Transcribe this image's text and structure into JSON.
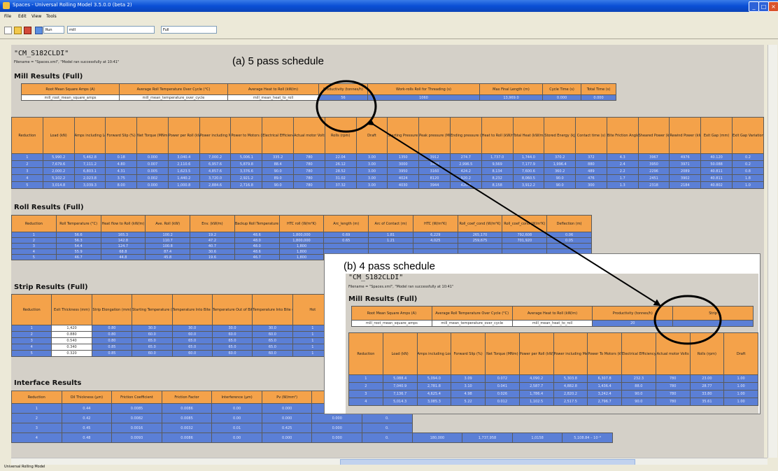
{
  "window": {
    "title": "Spaces - Universal Rolling Model 3.5.0.0 (beta 2)",
    "buttons": {
      "min": "_",
      "max": "□",
      "close": "×"
    }
  },
  "menu": [
    "File",
    "Edit",
    "View",
    "Tools"
  ],
  "toolbar": {
    "field1": "Run",
    "field2": "mill",
    "field3": "Full"
  },
  "report": {
    "title": "\"CM_S182CLDI\"",
    "filename": "Filename = \"Spaces.xml\", \"Model ran successfully at 10:41\""
  },
  "annotations": {
    "a": "(a) 5 pass schedule",
    "b": "(b) 4 pass schedule"
  },
  "mill": {
    "heading": "Mill Results (Full)",
    "summary_headers": [
      "Root Mean Square Amps (A)",
      "Average Roll Temperature Over Cycle (°C)",
      "Average Heat to Roll (kW/m)",
      "Productivity (tonnes/h)",
      "Work-rolls Roll for Threading (s)",
      "Max Final Length (m)",
      "Cycle Time (s)",
      "Total Time (s)"
    ],
    "summary_values": [
      "mill_root_mean_square_amps",
      "mill_mean_temperature_over_cycle",
      "mill_mean_heat_to_roll",
      "56",
      "1060",
      "13,969.0",
      "0.000",
      "0.000"
    ],
    "detail_headers": [
      "Reduction",
      "Load (kN)",
      "Amps including Losses",
      "Forward Slip (%)",
      "Net Torque (MNm)",
      "Power per Roll (kW)",
      "Power including Mechanical Losses (kW)",
      "Power to Motors (kW)",
      "Electrical Efficiency (%)",
      "Actual motor Volts",
      "Rolls (rpm)",
      "Draft",
      "Starting Pressure (MPa)",
      "Peak pressure (MPa)",
      "Ending pressure (MPa)",
      "Heat to Roll (kW/m)",
      "Total Heat (kW/m)",
      "Stored Energy (kJ/m)",
      "Contact time (s)",
      "Bite Friction Angle (°)",
      "Sheared Power (kW)",
      "Rewind Power (kW)",
      "Exit Gap (mm)",
      "Exit Gap Variation"
    ],
    "detail_rows": [
      [
        "1",
        "5,990.2",
        "5,462.8",
        "0.18",
        "0.000",
        "3,040.4",
        "7,000.2",
        "5,006.1",
        "335.2",
        "780",
        "22.04",
        "3.00",
        "1350",
        "3912",
        "274.7",
        "1,737.0",
        "1,744.0",
        "370.2",
        "372",
        "4.3",
        "3967",
        "4976",
        "40.120",
        "0.2"
      ],
      [
        "2",
        "7,679.6",
        "7,111.2",
        "4.80",
        "0.007",
        "2,110.6",
        "6,957.6",
        "5,879.8",
        "88.4",
        "780",
        "26.12",
        "3.00",
        "3000",
        "3400",
        "2,996.5",
        "9,569",
        "7,177.9",
        "1,996.4",
        "880",
        "2.4",
        "3950",
        "3971",
        "50.088",
        "0.2"
      ],
      [
        "3",
        "2,000.2",
        "6,803.1",
        "4.31",
        "0.005",
        "1,623.5",
        "4,857.6",
        "3,376.6",
        "90.0",
        "780",
        "28.52",
        "3.00",
        "3950",
        "3160",
        "424.2",
        "8,134",
        "7,600.6",
        "360.2",
        "489",
        "2.2",
        "2296",
        "2089",
        "40.811",
        "0.8"
      ],
      [
        "4",
        "5,102.2",
        "2,023.8",
        "3.75",
        "0.002",
        "1,440.2",
        "3,720.0",
        "2,921.2",
        "89.0",
        "780",
        "31.02",
        "3.00",
        "4024",
        "8120",
        "920.2",
        "8,232",
        "8,060.5",
        "90.0",
        "476",
        "1.7",
        "2451",
        "3902",
        "40.811",
        "1.8"
      ],
      [
        "5",
        "3,014.8",
        "3,039.3",
        "8.00",
        "0.000",
        "1,000.8",
        "2,884.6",
        "2,716.8",
        "90.0",
        "780",
        "37.32",
        "3.00",
        "4030",
        "3944",
        "420.8",
        "8,158",
        "3,912.2",
        "90.0",
        "300",
        "1.3",
        "2318",
        "2184",
        "40.802",
        "1.0"
      ]
    ]
  },
  "roll": {
    "heading": "Roll Results (Full)",
    "headers": [
      "Reduction",
      "Roll Temperature (°C)",
      "Heat flow to Roll (kW/m)",
      "Ave. Roll (kW)",
      "Env. (kW/m)",
      "Backup Roll Temperature (°C)",
      "HTC roll (W/m²K)",
      "Arc_length (m)",
      "Arc of Contact (m)",
      "HTC (W/m²K)",
      "Roll_coef_cond (W/m²K)",
      "Roll_coef_cond (W/m²K)",
      "Deflection (m)"
    ],
    "rows": [
      [
        "1",
        "56.6",
        "165.3",
        "100.2",
        "19.2",
        "48.6",
        "1,800,000",
        "0.69",
        "1.81",
        "6,229",
        "265,170",
        "792,608",
        "0.06"
      ],
      [
        "2",
        "56.3",
        "142.8",
        "110.7",
        "47.2",
        "48.0",
        "1,800,000",
        "0.65",
        "1.21",
        "4,025",
        "259,675",
        "701,920",
        "0.05"
      ],
      [
        "3",
        "54.4",
        "124.7",
        "100.8",
        "40.7",
        "48.0",
        "1,800",
        "",
        "",
        "",
        "",
        "",
        ""
      ],
      [
        "4",
        "55.9",
        "68.8",
        "87.4",
        "30.6",
        "48.6",
        "1,800",
        "",
        "",
        "",
        "",
        "",
        ""
      ],
      [
        "5",
        "46.7",
        "44.8",
        "45.8",
        "19.6",
        "46.7",
        "1,800",
        "",
        "",
        "",
        "",
        "",
        ""
      ]
    ]
  },
  "strip": {
    "heading": "Strip Results (Full)",
    "headers": [
      "Reduction",
      "Exit Thickness (mm)",
      "Strip Elongation (mm)",
      "Starting Temperature (°C)",
      "Temperature Into Bite (°C)",
      "Temperature Out of Bite (°C)",
      "Temperature Into Bite (°C)",
      "Hot"
    ],
    "rows": [
      [
        "1",
        "1,420",
        "0.80",
        "30.0",
        "30.0",
        "30.0",
        "30.0",
        "1"
      ],
      [
        "2",
        "0.880",
        "0.80",
        "60.0",
        "60.0",
        "60.0",
        "60.0",
        "1"
      ],
      [
        "3",
        "0.540",
        "0.80",
        "65.0",
        "65.0",
        "65.0",
        "65.0",
        "1"
      ],
      [
        "4",
        "0.340",
        "0.85",
        "65.0",
        "65.0",
        "65.0",
        "65.0",
        "1"
      ],
      [
        "5",
        "0.320",
        "0.85",
        "60.0",
        "60.0",
        "60.0",
        "60.0",
        "1"
      ]
    ]
  },
  "interface": {
    "heading": "Interface Results",
    "headers": [
      "Reduction",
      "Oil Thickness (µm)",
      "Friction Coefficient",
      "Friction Factor",
      "Interference (µm)",
      "Pv (W/mm²)",
      "Fsep (W/mm²)",
      "Metal"
    ],
    "rows": [
      [
        "1",
        "0.44",
        "0.0085",
        "0.0086",
        "0.00",
        "0.000",
        "0.000",
        "0."
      ],
      [
        "2",
        "0.42",
        "0.0082",
        "0.0085",
        "0.00",
        "0.000",
        "0.000",
        "0."
      ],
      [
        "3",
        "0.45",
        "0.0016",
        "0.0032",
        "0.01",
        "0.425",
        "0.000",
        "0."
      ],
      [
        "4",
        "0.48",
        "0.0093",
        "0.0086",
        "0.00",
        "0.000",
        "0.000",
        "0."
      ]
    ],
    "row4_extra": [
      "180,000",
      "1,737,958",
      "1,0158",
      "5,108.84 – 10⁻⁶"
    ]
  },
  "inset": {
    "title": "\"CM_S182CLDI\"",
    "filename": "Filename = \"Spaces.xml\", \"Model ran successfully at 10:41\"",
    "heading": "Mill Results (Full)",
    "summary_headers": [
      "Root Mean Square Amps (A)",
      "Average Roll Temperature Over Cycle (°C)",
      "Average Heat to Roll (kW/m)",
      "Productivity (tonnes/h)",
      "Strip"
    ],
    "summary_values": [
      "mill_root_mean_square_amps",
      "mill_mean_temperature_over_cycle",
      "mill_mean_heat_to_roll",
      "20",
      ""
    ],
    "detail_headers": [
      "Reduction",
      "Load (kN)",
      "Amps including Losses",
      "Forward Slip (%)",
      "Net Torque (MNm)",
      "Power per Roll (kW)",
      "Power including Mechanical Losses (kW)",
      "Power To Motors (kW)",
      "Electrical Efficiency (%)",
      "Actual motor Volts",
      "Rolls (rpm)",
      "Draft"
    ],
    "detail_rows": [
      [
        "1",
        "5,088.4",
        "5,094.0",
        "3.09",
        "0.072",
        "4,090.2",
        "5,303.8",
        "6,307.8",
        "232.3",
        "780",
        "23.00",
        "1.00"
      ],
      [
        "2",
        "7,040.9",
        "2,781.8",
        "3.10",
        "0.041",
        "2,587.7",
        "4,882.8",
        "1,436.4",
        "88.0",
        "780",
        "28.77",
        "1.00"
      ],
      [
        "3",
        "7,136.7",
        "4,625.4",
        "4.98",
        "0.026",
        "1,786.4",
        "2,820.2",
        "3,242.4",
        "90.0",
        "780",
        "33.80",
        "1.00"
      ],
      [
        "4",
        "5,014.3",
        "3,085.3",
        "5.22",
        "0.012",
        "1,102.5",
        "2,517.5",
        "2,796.7",
        "90.0",
        "780",
        "35.61",
        "1.00"
      ]
    ]
  },
  "status": {
    "text": "Universal Rolling Model"
  }
}
